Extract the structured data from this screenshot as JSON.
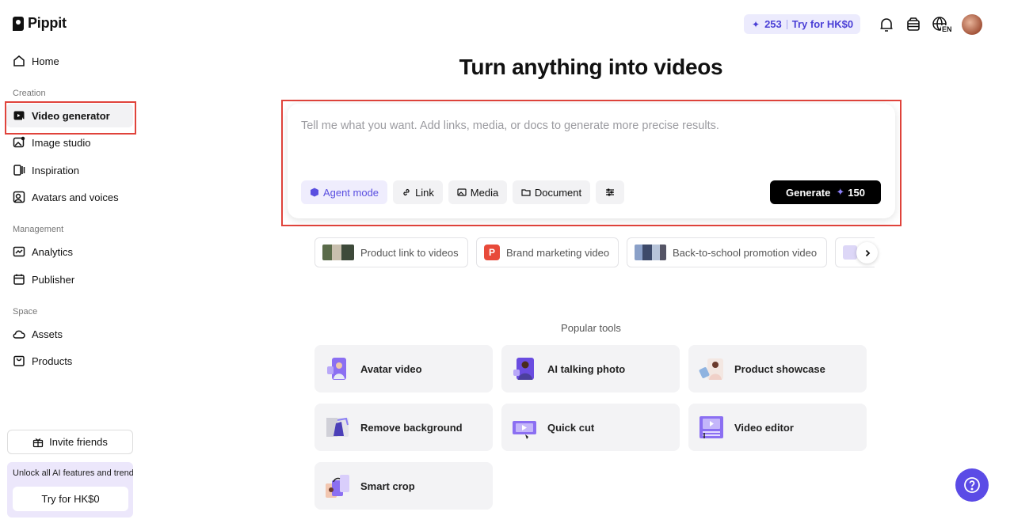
{
  "app": {
    "name": "Pippit"
  },
  "sidebar": {
    "home": "Home",
    "sections": {
      "creation": "Creation",
      "management": "Management",
      "space": "Space"
    },
    "items": {
      "video_generator": "Video generator",
      "image_studio": "Image studio",
      "inspiration": "Inspiration",
      "avatars_voices": "Avatars and voices",
      "analytics": "Analytics",
      "publisher": "Publisher",
      "assets": "Assets",
      "products": "Products"
    },
    "invite": "Invite friends",
    "promo": {
      "text": "Unlock all AI features and trend",
      "button": "Try for HK$0"
    }
  },
  "topbar": {
    "credits": "253",
    "trial": "Try for HK$0",
    "lang_badge": "EN"
  },
  "main": {
    "title": "Turn anything into videos",
    "prompt": {
      "placeholder": "Tell me what you want. Add links, media, or docs to generate more precise results.",
      "agent_mode": "Agent mode",
      "link": "Link",
      "media": "Media",
      "document": "Document",
      "generate": "Generate",
      "generate_cost": "150"
    },
    "suggestions": [
      "Product link to videos",
      "Brand marketing video",
      "Back-to-school promotion video"
    ],
    "suggestion_badge": "P",
    "popular_label": "Popular tools",
    "tools": [
      "Avatar video",
      "AI talking photo",
      "Product showcase",
      "Remove background",
      "Quick cut",
      "Video editor",
      "Smart crop"
    ]
  },
  "colors": {
    "accent": "#5b4be6",
    "highlight": "#e0433b"
  }
}
